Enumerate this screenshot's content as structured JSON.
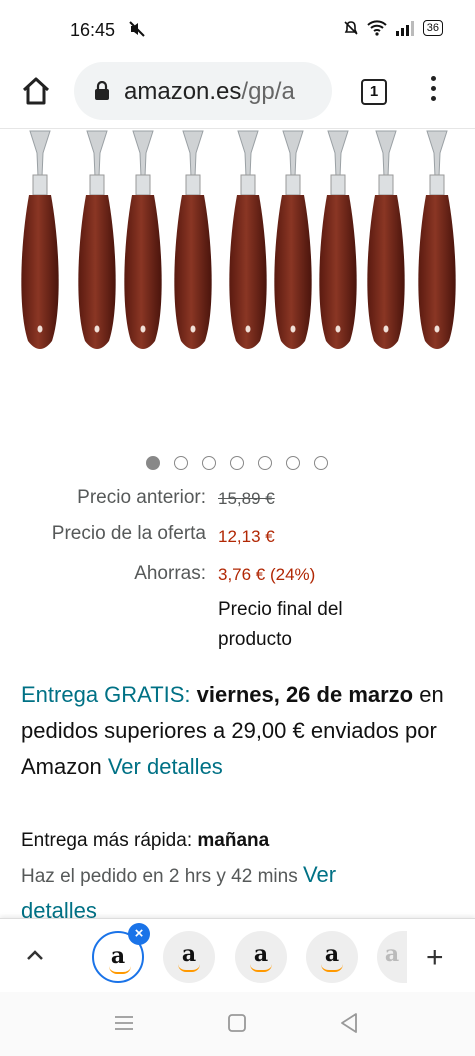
{
  "status_bar": {
    "time": "16:45",
    "mute_icon": "mute-icon",
    "battery": "36"
  },
  "browser": {
    "url_host": "amazon.es",
    "url_path": "/gp/a",
    "tab_count": "1"
  },
  "carousel": {
    "total": 7,
    "active_index": 0
  },
  "price": {
    "previous_label": "Precio anterior:",
    "previous_value": "15,89 €",
    "offer_label": "Precio de la oferta",
    "offer_value": "12,13 €",
    "savings_label": "Ahorras:",
    "savings_value": "3,76 € (24%)",
    "final_note": "Precio final del producto"
  },
  "delivery": {
    "free_label": "Entrega GRATIS:",
    "date": "viernes, 26 de marzo",
    "text": "en pedidos superiores a 29,00 € enviados por Amazon",
    "link": "Ver detalles"
  },
  "fast_delivery": {
    "label": "Entrega más rápida:",
    "day": "mañana",
    "order_within": "Haz el pedido en 2 hrs y 42 mins",
    "link_part1": "Ver",
    "link_part2": "detalles"
  },
  "tabs_bar": {
    "tab_letter": "a",
    "close_label": "×",
    "add_label": "+"
  },
  "colors": {
    "price_red": "#b12704",
    "link_teal": "#007185",
    "active_tab_blue": "#1a73e8",
    "knife_handle": "#7a2a1c"
  }
}
